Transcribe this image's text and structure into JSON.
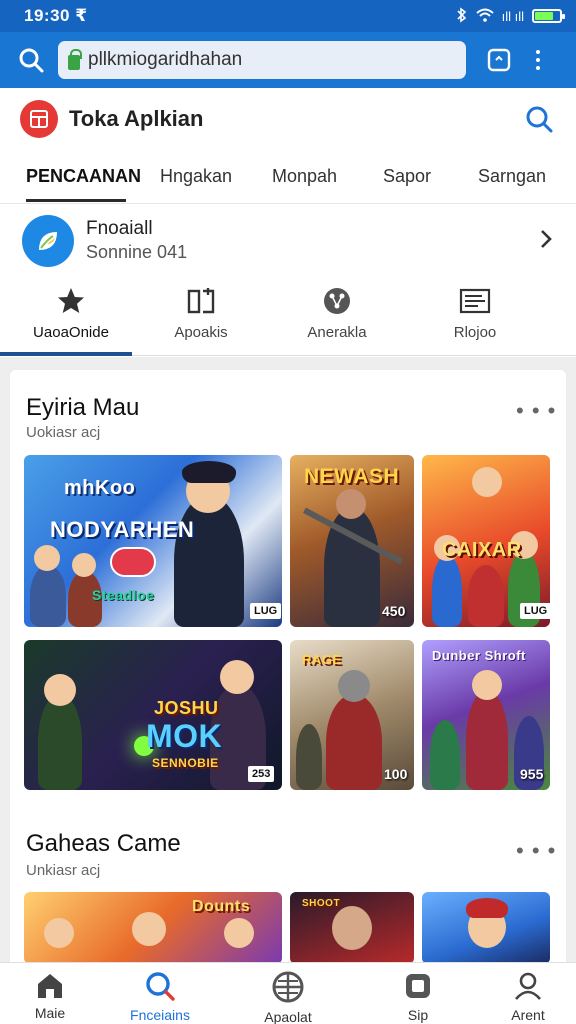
{
  "status": {
    "time": "19:30 ₹",
    "signal_text": "ıll ıll"
  },
  "browser": {
    "url": "pllkmiogaridhahan"
  },
  "app": {
    "title": "Toka Aplkian"
  },
  "top_tabs": [
    {
      "label": "PENCAANAN",
      "active": true
    },
    {
      "label": "Hngakan",
      "active": false
    },
    {
      "label": "Monpah",
      "active": false
    },
    {
      "label": "Sapor",
      "active": false
    },
    {
      "label": "Sarngan",
      "active": false
    }
  ],
  "account": {
    "name": "Fnoaiall",
    "subtitle": "Sonnine  041"
  },
  "category_tabs": [
    {
      "label": "UaoaOnide",
      "icon": "star-icon",
      "active": true
    },
    {
      "label": "Apoakis",
      "icon": "device-icon",
      "active": false
    },
    {
      "label": "Anerakla",
      "icon": "compass-icon",
      "active": false
    },
    {
      "label": "Rlojoo",
      "icon": "news-icon",
      "active": false
    }
  ],
  "sections": [
    {
      "title": "Eyiria Mau",
      "subtitle": "Uokiasr acj",
      "more": "• • •",
      "tiles": [
        {
          "title": "NODYARHEN",
          "top_text": "mhKoo",
          "sub_text": "Steadloe",
          "badge": "LUG",
          "accent": "#2d6fd8"
        },
        {
          "title": "NEWASH",
          "number": "450",
          "accent": "#b86a2c"
        },
        {
          "title": "CAIXAR",
          "badge": "LUG",
          "accent": "#e84a2a"
        },
        {
          "title": "MOK",
          "top_text": "JOSHU",
          "sub_text": "SENNOBIE",
          "badge": "253",
          "accent": "#1a6b3a"
        },
        {
          "title": "RAGE",
          "number": "100",
          "accent": "#7a4a2c"
        },
        {
          "title": "Dunber Shroft",
          "number": "955",
          "accent": "#6a3aa8"
        }
      ]
    },
    {
      "title": "Gaheas Came",
      "subtitle": "Unkiasr acj",
      "more": "• • •",
      "tiles": [
        {
          "title": "Dounts",
          "accent": "#d65a2a"
        },
        {
          "title": "SHOOT",
          "accent": "#b82a2a"
        },
        {
          "title": "",
          "accent": "#2a6ad0"
        }
      ]
    }
  ],
  "bottom_nav": [
    {
      "label": "Maie",
      "icon": "home-icon",
      "active": false
    },
    {
      "label": "Fnceiains",
      "icon": "search-icon",
      "active": true
    },
    {
      "label": "Apaolat",
      "icon": "globe-icon",
      "active": false
    },
    {
      "label": "Sip",
      "icon": "gamepad-icon",
      "active": false
    },
    {
      "label": "Arent",
      "icon": "profile-icon",
      "active": false
    }
  ],
  "colors": {
    "status_bar": "#1565c0",
    "url_bar": "#1976d2",
    "accent_blue": "#1e73d8",
    "logo_red": "#e53935"
  }
}
